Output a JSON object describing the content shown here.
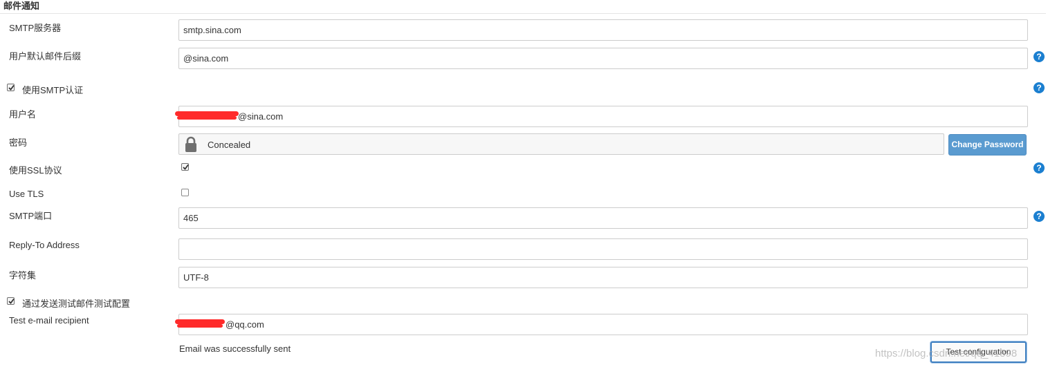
{
  "section": {
    "title": "邮件通知"
  },
  "smtp_server": {
    "label": "SMTP服务器",
    "value": "smtp.sina.com"
  },
  "default_suffix": {
    "label": "用户默认邮件后缀",
    "value": "@sina.com"
  },
  "use_smtp_auth": {
    "label": "使用SMTP认证",
    "checked": true
  },
  "username": {
    "label": "用户名",
    "value": "@sina.com"
  },
  "password": {
    "label": "密码",
    "value": "Concealed",
    "change_label": "Change Password"
  },
  "use_ssl": {
    "label": "使用SSL协议",
    "checked": true
  },
  "use_tls": {
    "label": "Use TLS",
    "checked": false
  },
  "smtp_port": {
    "label": "SMTP端口",
    "value": "465"
  },
  "reply_to": {
    "label": "Reply-To Address",
    "value": ""
  },
  "charset": {
    "label": "字符集",
    "value": "UTF-8"
  },
  "test_by_send": {
    "label": "通过发送测试邮件测试配置",
    "checked": true
  },
  "test_recipient": {
    "label": "Test e-mail recipient",
    "value": "@qq.com"
  },
  "status": {
    "text": "Email was successfully sent"
  },
  "test_button": {
    "label": "Test configuration"
  },
  "help": {
    "glyph": "?"
  },
  "watermark": {
    "text": "https://blog.csdn.net/qq_41898"
  },
  "colors": {
    "accent": "#1b7fd0",
    "button": "#5a9bd0",
    "redaction": "#ff2b2b"
  }
}
